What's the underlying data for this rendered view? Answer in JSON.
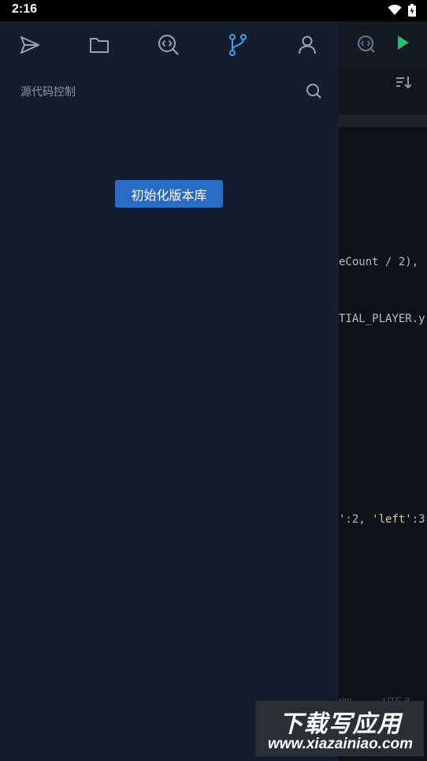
{
  "status_bar": {
    "time": "2:16"
  },
  "drawer": {
    "tabs": [
      {
        "name": "send-icon"
      },
      {
        "name": "folder-icon"
      },
      {
        "name": "code-search-icon"
      },
      {
        "name": "git-branch-icon",
        "active": true
      },
      {
        "name": "user-icon"
      }
    ],
    "panel_title": "源代码控制",
    "init_button_label": "初始化版本库",
    "accent_color": "#3fa0ea",
    "button_color": "#2a6bc6"
  },
  "editor": {
    "code_lines": [
      {
        "text": "eCount / 2),"
      },
      {
        "text": "TIAL_PLAYER.y"
      },
      {
        "pre": "':2, ",
        "str": "'left'",
        "post": ":3"
      }
    ],
    "statusbar": {
      "mode": "ript",
      "encoding": "UTF-8"
    }
  },
  "watermark": {
    "title": "下载写应用",
    "url": "www.xiazainiao.com"
  }
}
